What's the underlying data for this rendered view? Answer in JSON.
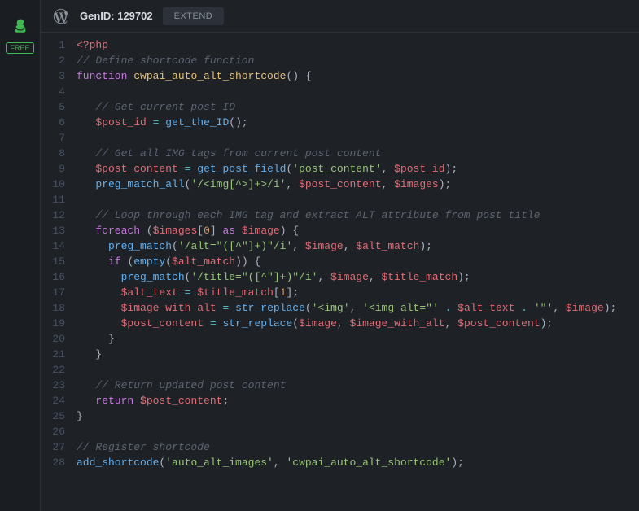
{
  "leftRail": {
    "badge": "FREE"
  },
  "header": {
    "genIdLabel": "GenID: 129702",
    "extendLabel": "EXTEND"
  },
  "code": {
    "lineCount": 28,
    "lines": [
      [
        {
          "c": "tk-tag",
          "t": "<?php"
        }
      ],
      [
        {
          "c": "tk-comment",
          "t": "// Define shortcode function"
        }
      ],
      [
        {
          "c": "tk-keyword",
          "t": "function"
        },
        {
          "c": "tk-plain",
          "t": " "
        },
        {
          "c": "tk-funcname",
          "t": "cwpai_auto_alt_shortcode"
        },
        {
          "c": "tk-paren",
          "t": "()"
        },
        {
          "c": "tk-plain",
          "t": " "
        },
        {
          "c": "tk-brace",
          "t": "{"
        }
      ],
      [],
      [
        {
          "c": "tk-plain",
          "t": "   "
        },
        {
          "c": "tk-comment",
          "t": "// Get current post ID"
        }
      ],
      [
        {
          "c": "tk-plain",
          "t": "   "
        },
        {
          "c": "tk-var",
          "t": "$post_id"
        },
        {
          "c": "tk-plain",
          "t": " "
        },
        {
          "c": "tk-op",
          "t": "="
        },
        {
          "c": "tk-plain",
          "t": " "
        },
        {
          "c": "tk-func",
          "t": "get_the_ID"
        },
        {
          "c": "tk-paren",
          "t": "();"
        }
      ],
      [],
      [
        {
          "c": "tk-plain",
          "t": "   "
        },
        {
          "c": "tk-comment",
          "t": "// Get all IMG tags from current post content"
        }
      ],
      [
        {
          "c": "tk-plain",
          "t": "   "
        },
        {
          "c": "tk-var",
          "t": "$post_content"
        },
        {
          "c": "tk-plain",
          "t": " "
        },
        {
          "c": "tk-op",
          "t": "="
        },
        {
          "c": "tk-plain",
          "t": " "
        },
        {
          "c": "tk-func",
          "t": "get_post_field"
        },
        {
          "c": "tk-paren",
          "t": "("
        },
        {
          "c": "tk-str",
          "t": "'post_content'"
        },
        {
          "c": "tk-plain",
          "t": ", "
        },
        {
          "c": "tk-var",
          "t": "$post_id"
        },
        {
          "c": "tk-paren",
          "t": ");"
        }
      ],
      [
        {
          "c": "tk-plain",
          "t": "   "
        },
        {
          "c": "tk-func",
          "t": "preg_match_all"
        },
        {
          "c": "tk-paren",
          "t": "("
        },
        {
          "c": "tk-str",
          "t": "'/<img[^>]+>/i'"
        },
        {
          "c": "tk-plain",
          "t": ", "
        },
        {
          "c": "tk-var",
          "t": "$post_content"
        },
        {
          "c": "tk-plain",
          "t": ", "
        },
        {
          "c": "tk-var",
          "t": "$images"
        },
        {
          "c": "tk-paren",
          "t": ");"
        }
      ],
      [],
      [
        {
          "c": "tk-plain",
          "t": "   "
        },
        {
          "c": "tk-comment",
          "t": "// Loop through each IMG tag and extract ALT attribute from post title"
        }
      ],
      [
        {
          "c": "tk-plain",
          "t": "   "
        },
        {
          "c": "tk-keyword",
          "t": "foreach"
        },
        {
          "c": "tk-plain",
          "t": " "
        },
        {
          "c": "tk-paren",
          "t": "("
        },
        {
          "c": "tk-var",
          "t": "$images"
        },
        {
          "c": "tk-paren",
          "t": "["
        },
        {
          "c": "tk-num",
          "t": "0"
        },
        {
          "c": "tk-paren",
          "t": "]"
        },
        {
          "c": "tk-plain",
          "t": " "
        },
        {
          "c": "tk-keyword",
          "t": "as"
        },
        {
          "c": "tk-plain",
          "t": " "
        },
        {
          "c": "tk-var",
          "t": "$image"
        },
        {
          "c": "tk-paren",
          "t": ")"
        },
        {
          "c": "tk-plain",
          "t": " "
        },
        {
          "c": "tk-brace",
          "t": "{"
        }
      ],
      [
        {
          "c": "tk-plain",
          "t": "     "
        },
        {
          "c": "tk-func",
          "t": "preg_match"
        },
        {
          "c": "tk-paren",
          "t": "("
        },
        {
          "c": "tk-str",
          "t": "'/alt=\"([^\"]+)\"/i'"
        },
        {
          "c": "tk-plain",
          "t": ", "
        },
        {
          "c": "tk-var",
          "t": "$image"
        },
        {
          "c": "tk-plain",
          "t": ", "
        },
        {
          "c": "tk-var",
          "t": "$alt_match"
        },
        {
          "c": "tk-paren",
          "t": ");"
        }
      ],
      [
        {
          "c": "tk-plain",
          "t": "     "
        },
        {
          "c": "tk-keyword",
          "t": "if"
        },
        {
          "c": "tk-plain",
          "t": " "
        },
        {
          "c": "tk-paren",
          "t": "("
        },
        {
          "c": "tk-func",
          "t": "empty"
        },
        {
          "c": "tk-paren",
          "t": "("
        },
        {
          "c": "tk-var",
          "t": "$alt_match"
        },
        {
          "c": "tk-paren",
          "t": "))"
        },
        {
          "c": "tk-plain",
          "t": " "
        },
        {
          "c": "tk-brace",
          "t": "{"
        }
      ],
      [
        {
          "c": "tk-plain",
          "t": "       "
        },
        {
          "c": "tk-func",
          "t": "preg_match"
        },
        {
          "c": "tk-paren",
          "t": "("
        },
        {
          "c": "tk-str",
          "t": "'/title=\"([^\"]+)\"/i'"
        },
        {
          "c": "tk-plain",
          "t": ", "
        },
        {
          "c": "tk-var",
          "t": "$image"
        },
        {
          "c": "tk-plain",
          "t": ", "
        },
        {
          "c": "tk-var",
          "t": "$title_match"
        },
        {
          "c": "tk-paren",
          "t": ");"
        }
      ],
      [
        {
          "c": "tk-plain",
          "t": "       "
        },
        {
          "c": "tk-var",
          "t": "$alt_text"
        },
        {
          "c": "tk-plain",
          "t": " "
        },
        {
          "c": "tk-op",
          "t": "="
        },
        {
          "c": "tk-plain",
          "t": " "
        },
        {
          "c": "tk-var",
          "t": "$title_match"
        },
        {
          "c": "tk-paren",
          "t": "["
        },
        {
          "c": "tk-num",
          "t": "1"
        },
        {
          "c": "tk-paren",
          "t": "];"
        }
      ],
      [
        {
          "c": "tk-plain",
          "t": "       "
        },
        {
          "c": "tk-var",
          "t": "$image_with_alt"
        },
        {
          "c": "tk-plain",
          "t": " "
        },
        {
          "c": "tk-op",
          "t": "="
        },
        {
          "c": "tk-plain",
          "t": " "
        },
        {
          "c": "tk-func",
          "t": "str_replace"
        },
        {
          "c": "tk-paren",
          "t": "("
        },
        {
          "c": "tk-str",
          "t": "'<img'"
        },
        {
          "c": "tk-plain",
          "t": ", "
        },
        {
          "c": "tk-str",
          "t": "'<img alt=\"'"
        },
        {
          "c": "tk-plain",
          "t": " "
        },
        {
          "c": "tk-op",
          "t": "."
        },
        {
          "c": "tk-plain",
          "t": " "
        },
        {
          "c": "tk-var",
          "t": "$alt_text"
        },
        {
          "c": "tk-plain",
          "t": " "
        },
        {
          "c": "tk-op",
          "t": "."
        },
        {
          "c": "tk-plain",
          "t": " "
        },
        {
          "c": "tk-str",
          "t": "'\"'"
        },
        {
          "c": "tk-plain",
          "t": ", "
        },
        {
          "c": "tk-var",
          "t": "$image"
        },
        {
          "c": "tk-paren",
          "t": ");"
        }
      ],
      [
        {
          "c": "tk-plain",
          "t": "       "
        },
        {
          "c": "tk-var",
          "t": "$post_content"
        },
        {
          "c": "tk-plain",
          "t": " "
        },
        {
          "c": "tk-op",
          "t": "="
        },
        {
          "c": "tk-plain",
          "t": " "
        },
        {
          "c": "tk-func",
          "t": "str_replace"
        },
        {
          "c": "tk-paren",
          "t": "("
        },
        {
          "c": "tk-var",
          "t": "$image"
        },
        {
          "c": "tk-plain",
          "t": ", "
        },
        {
          "c": "tk-var",
          "t": "$image_with_alt"
        },
        {
          "c": "tk-plain",
          "t": ", "
        },
        {
          "c": "tk-var",
          "t": "$post_content"
        },
        {
          "c": "tk-paren",
          "t": ");"
        }
      ],
      [
        {
          "c": "tk-plain",
          "t": "     "
        },
        {
          "c": "tk-brace",
          "t": "}"
        }
      ],
      [
        {
          "c": "tk-plain",
          "t": "   "
        },
        {
          "c": "tk-brace",
          "t": "}"
        }
      ],
      [],
      [
        {
          "c": "tk-plain",
          "t": "   "
        },
        {
          "c": "tk-comment",
          "t": "// Return updated post content"
        }
      ],
      [
        {
          "c": "tk-plain",
          "t": "   "
        },
        {
          "c": "tk-keyword",
          "t": "return"
        },
        {
          "c": "tk-plain",
          "t": " "
        },
        {
          "c": "tk-var",
          "t": "$post_content"
        },
        {
          "c": "tk-plain",
          "t": ";"
        }
      ],
      [
        {
          "c": "tk-brace",
          "t": "}"
        }
      ],
      [],
      [
        {
          "c": "tk-comment",
          "t": "// Register shortcode"
        }
      ],
      [
        {
          "c": "tk-func",
          "t": "add_shortcode"
        },
        {
          "c": "tk-paren",
          "t": "("
        },
        {
          "c": "tk-str",
          "t": "'auto_alt_images'"
        },
        {
          "c": "tk-plain",
          "t": ", "
        },
        {
          "c": "tk-str",
          "t": "'cwpai_auto_alt_shortcode'"
        },
        {
          "c": "tk-paren",
          "t": ");"
        }
      ]
    ]
  }
}
